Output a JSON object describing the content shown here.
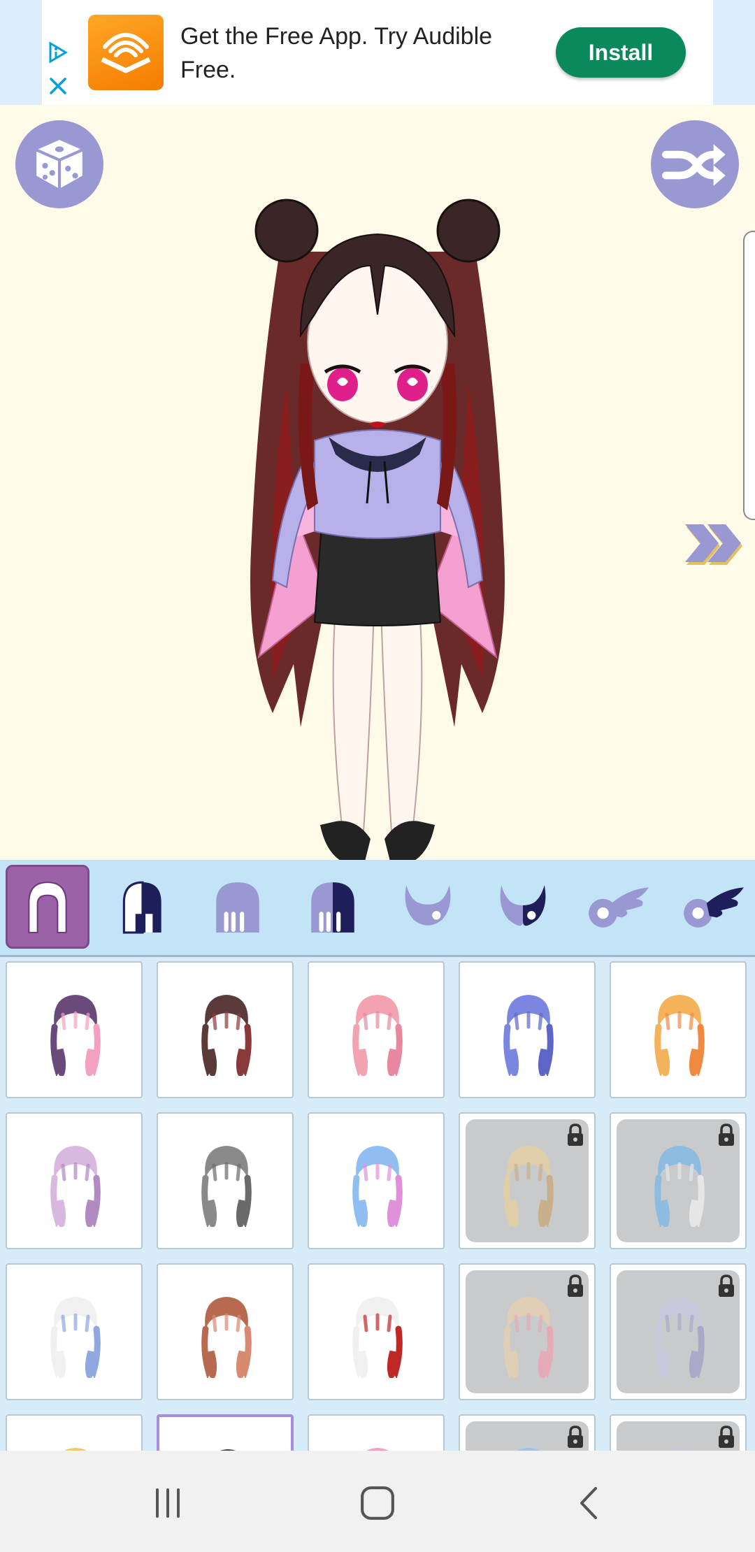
{
  "ad": {
    "text": "Get the Free App. Try Audible Free.",
    "install_label": "Install",
    "accent": "#0a8a5a"
  },
  "stage": {
    "background": "#fffbe8",
    "buttons": {
      "randomize_icon": "dice-icon",
      "shuffle_icon": "shuffle-icon",
      "next_icon": "double-chevron-right-icon"
    }
  },
  "categories": [
    {
      "icon": "hair-full-icon",
      "selected": true
    },
    {
      "icon": "hair-two-tone-icon",
      "selected": false
    },
    {
      "icon": "bangs-icon",
      "selected": false
    },
    {
      "icon": "bangs-two-tone-icon",
      "selected": false
    },
    {
      "icon": "horns-icon",
      "selected": false
    },
    {
      "icon": "horns-two-tone-icon",
      "selected": false
    },
    {
      "icon": "wing-icon",
      "selected": false
    },
    {
      "icon": "wing-two-tone-icon",
      "selected": false
    }
  ],
  "grid_items": [
    {
      "hair": "#6a4a7a",
      "accent": "#f4a0c0",
      "locked": false,
      "selected": false
    },
    {
      "hair": "#5b3a3a",
      "accent": "#8a3a3a",
      "locked": false,
      "selected": false
    },
    {
      "hair": "#f2a2b0",
      "accent": "#e888a0",
      "locked": false,
      "selected": false
    },
    {
      "hair": "#7a86e0",
      "accent": "#5d66c8",
      "locked": false,
      "selected": false
    },
    {
      "hair": "#f4b25a",
      "accent": "#f08a40",
      "locked": false,
      "selected": false
    },
    {
      "hair": "#d9b8e0",
      "accent": "#b08ac0",
      "locked": false,
      "selected": false
    },
    {
      "hair": "#8a8a8a",
      "accent": "#6a6a6a",
      "locked": false,
      "selected": false
    },
    {
      "hair": "#8fbff2",
      "accent": "#e090d8",
      "locked": false,
      "selected": false
    },
    {
      "hair": "#e8d0a0",
      "accent": "#c8a878",
      "locked": true,
      "selected": false
    },
    {
      "hair": "#7bb6e8",
      "accent": "#f0f0f0",
      "locked": true,
      "selected": false
    },
    {
      "hair": "#f0f0f0",
      "accent": "#8fa8e0",
      "locked": false,
      "selected": false
    },
    {
      "hair": "#b86a50",
      "accent": "#d88a70",
      "locked": false,
      "selected": false
    },
    {
      "hair": "#f0f0f0",
      "accent": "#c02828",
      "locked": false,
      "selected": false
    },
    {
      "hair": "#e8d0b0",
      "accent": "#f0a0b0",
      "locked": true,
      "selected": false
    },
    {
      "hair": "#c8c8e0",
      "accent": "#a0a0c8",
      "locked": true,
      "selected": false
    },
    {
      "hair": "#f0c870",
      "accent": "#e0a850",
      "locked": false,
      "selected": false
    },
    {
      "hair": "#4a3a3a",
      "accent": "#2a2020",
      "locked": false,
      "selected": true
    },
    {
      "hair": "#f4a0c0",
      "accent": "#e080a0",
      "locked": false,
      "selected": false
    },
    {
      "hair": "#8fbff2",
      "accent": "#6a9ad0",
      "locked": true,
      "selected": false
    },
    {
      "hair": "#c8c8e0",
      "accent": "#a0a0c8",
      "locked": true,
      "selected": false
    }
  ],
  "navbar": {
    "recents_icon": "recents-icon",
    "home_icon": "home-icon",
    "back_icon": "back-icon"
  }
}
